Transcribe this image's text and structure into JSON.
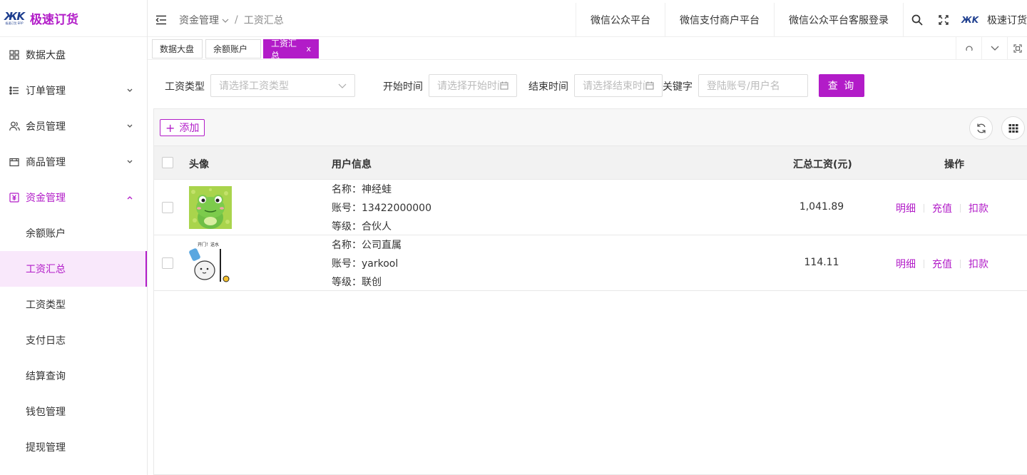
{
  "brand": {
    "name": "极速订货",
    "mark": "ЖK",
    "mark_sub": "极速订货 ERP"
  },
  "accent_color": "#b21cc8",
  "sidebar": {
    "items": [
      {
        "label": "数据大盘",
        "icon": "dashboard-grid-icon"
      },
      {
        "label": "订单管理",
        "icon": "list-icon"
      },
      {
        "label": "会员管理",
        "icon": "users-icon"
      },
      {
        "label": "商品管理",
        "icon": "card-icon"
      },
      {
        "label": "资金管理",
        "icon": "money-icon"
      }
    ],
    "submenu": [
      "余额账户",
      "工资汇总",
      "工资类型",
      "支付日志",
      "结算查询",
      "钱包管理",
      "提现管理"
    ],
    "active_submenu": "工资汇总"
  },
  "header": {
    "breadcrumb": {
      "parent": "资金管理",
      "current": "工资汇总",
      "separator": "/"
    },
    "links": [
      "微信公众平台",
      "微信支付商户平台",
      "微信公众平台客服登录"
    ],
    "user_name": "极速订货",
    "user_mark": "ЖK"
  },
  "tabs": [
    {
      "label": "数据大盘"
    },
    {
      "label": "余额账户"
    },
    {
      "label": "工资汇总",
      "close": "x"
    }
  ],
  "filters": {
    "salary_type": {
      "label": "工资类型",
      "placeholder": "请选择工资类型"
    },
    "start_time": {
      "label": "开始时间",
      "placeholder": "请选择开始时间"
    },
    "end_time": {
      "label": "结束时间",
      "placeholder": "请选择结束时间"
    },
    "keyword": {
      "label": "关键字",
      "placeholder": "登陆账号/用户名"
    },
    "query_label": "查 询"
  },
  "toolbar": {
    "add_label": "添加",
    "add_symbol": "+"
  },
  "table": {
    "columns": {
      "avatar": "头像",
      "user_info": "用户信息",
      "total": "汇总工资(元)",
      "ops": "操作"
    },
    "name_prefix": "名称：",
    "account_prefix": "账号：",
    "level_prefix": "等级：",
    "ops": [
      "明细",
      "充值",
      "扣款"
    ],
    "rows": [
      {
        "name": "神经蛙",
        "account": "13422000000",
        "level": "合伙人",
        "total": "1,041.89",
        "avatar": "frog-avatar"
      },
      {
        "name": "公司直属",
        "account": "yarkool",
        "level": "联创",
        "total": "114.11",
        "avatar": "water-delivery-avatar",
        "avatar_caption": "开门！送水"
      }
    ]
  }
}
